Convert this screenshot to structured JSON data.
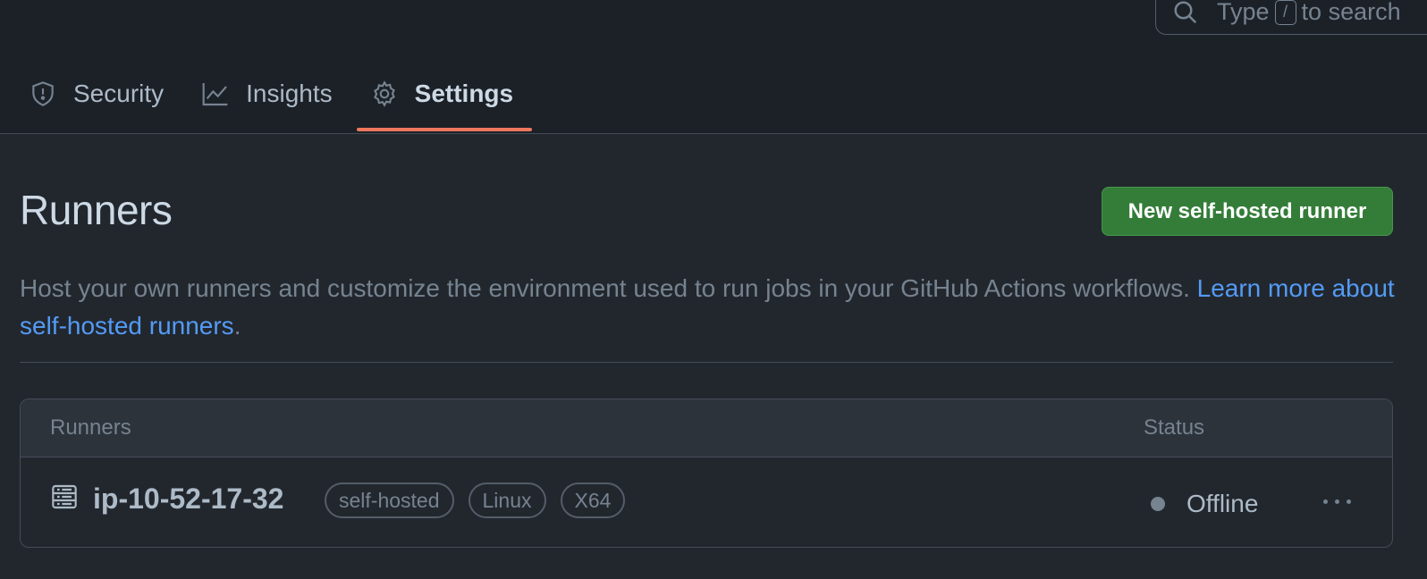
{
  "search": {
    "prefix": "Type",
    "key": "/",
    "suffix": "to search"
  },
  "tabs": [
    {
      "label": "Security",
      "icon": "shield-icon"
    },
    {
      "label": "Insights",
      "icon": "graph-icon"
    },
    {
      "label": "Settings",
      "icon": "gear-icon",
      "active": true
    }
  ],
  "page": {
    "title": "Runners",
    "new_button": "New self-hosted runner",
    "description": "Host your own runners and customize the environment used to run jobs in your GitHub Actions workflows.",
    "learn_more": "Learn more about self-hosted runners",
    "period": "."
  },
  "table": {
    "headers": {
      "runners": "Runners",
      "status": "Status"
    },
    "rows": [
      {
        "name": "ip-10-52-17-32",
        "labels": [
          "self-hosted",
          "Linux",
          "X64"
        ],
        "status": "Offline"
      }
    ]
  },
  "colors": {
    "accent": "#ec775c",
    "primary_button": "#347d39",
    "link": "#539bf5"
  }
}
